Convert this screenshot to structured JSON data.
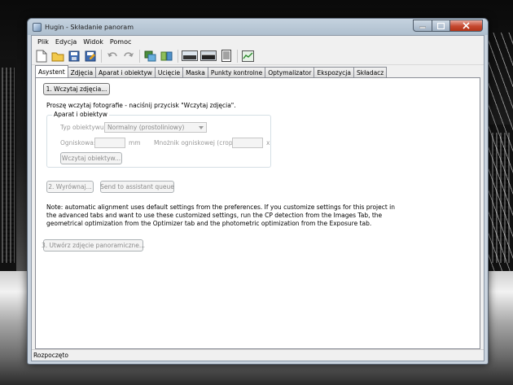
{
  "window": {
    "title": "Hugin - Składanie panoram"
  },
  "menu": [
    "Plik",
    "Edycja",
    "Widok",
    "Pomoc"
  ],
  "toolbar": {
    "icons": [
      "new-file-icon",
      "open-folder-icon",
      "save-icon",
      "save-as-icon",
      "undo-icon",
      "redo-icon",
      "add-images-icon",
      "control-points-icon",
      "preview-icon",
      "fast-preview-icon",
      "layout-icon",
      "optimize-icon"
    ]
  },
  "tabs": [
    "Asystent",
    "Zdjęcia",
    "Aparat i obiektyw",
    "Ucięcie",
    "Maska",
    "Punkty kontrolne",
    "Optymalizator",
    "Ekspozycja",
    "Składacz"
  ],
  "assistant": {
    "load_images_button": "1. Wczytaj zdjęcia...",
    "prompt": "Proszę wczytaj fotografie - naciśnij przycisk \"Wczytaj zdjęcia\".",
    "camera_group": {
      "label": "Aparat i obiektyw",
      "lens_type_label": "Typ obiektywu:",
      "lens_type_value": "Normalny (prostoliniowy)",
      "focal_label": "Ogniskowa:",
      "focal_unit": "mm",
      "crop_label": "Mnożnik ogniskowej (crop):",
      "crop_unit": "x",
      "load_lens_button": "Wczytaj obiektyw..."
    },
    "align_button": "2. Wyrównaj...",
    "queue_button": "Send to assistant queue",
    "note_lines": [
      "Note: automatic alignment uses default settings from the preferences. If you customize settings for this project in",
      "the advanced tabs and want to use these customized settings, run the CP detection from the Images Tab, the",
      "geometrical optimization from the Optimizer tab and the photometric optimization from the Exposure tab."
    ],
    "create_button": "3. Utwórz zdjęcie panoramiczne..."
  },
  "status": "Rozpoczęto"
}
